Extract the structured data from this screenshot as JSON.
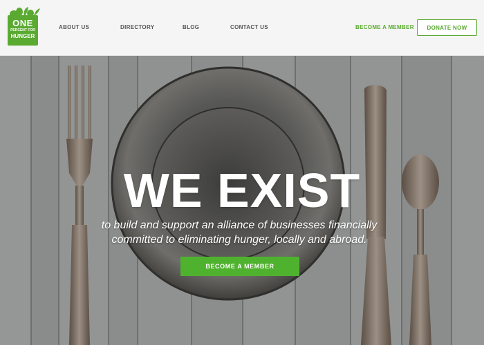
{
  "header": {
    "logo": {
      "line1": "ONE",
      "line2": "PERCENT FOR",
      "line3": "HUNGER"
    },
    "nav": [
      {
        "label": "ABOUT US"
      },
      {
        "label": "DIRECTORY"
      },
      {
        "label": "BLOG"
      },
      {
        "label": "CONTACT US"
      }
    ],
    "become_member_label": "BECOME A MEMBER",
    "donate_label": "DONATE NOW"
  },
  "hero": {
    "title": "WE EXIST",
    "subtitle": "to build and support an alliance of businesses financially committed to eliminating hunger, locally and abroad.",
    "cta_label": "BECOME A MEMBER"
  },
  "colors": {
    "brand_green": "#5aaa32",
    "button_green": "#4fb22f",
    "header_bg": "#f5f5f5",
    "nav_text": "#555555"
  },
  "icons": [
    "logo-bag-icon",
    "vegetables-icon"
  ]
}
